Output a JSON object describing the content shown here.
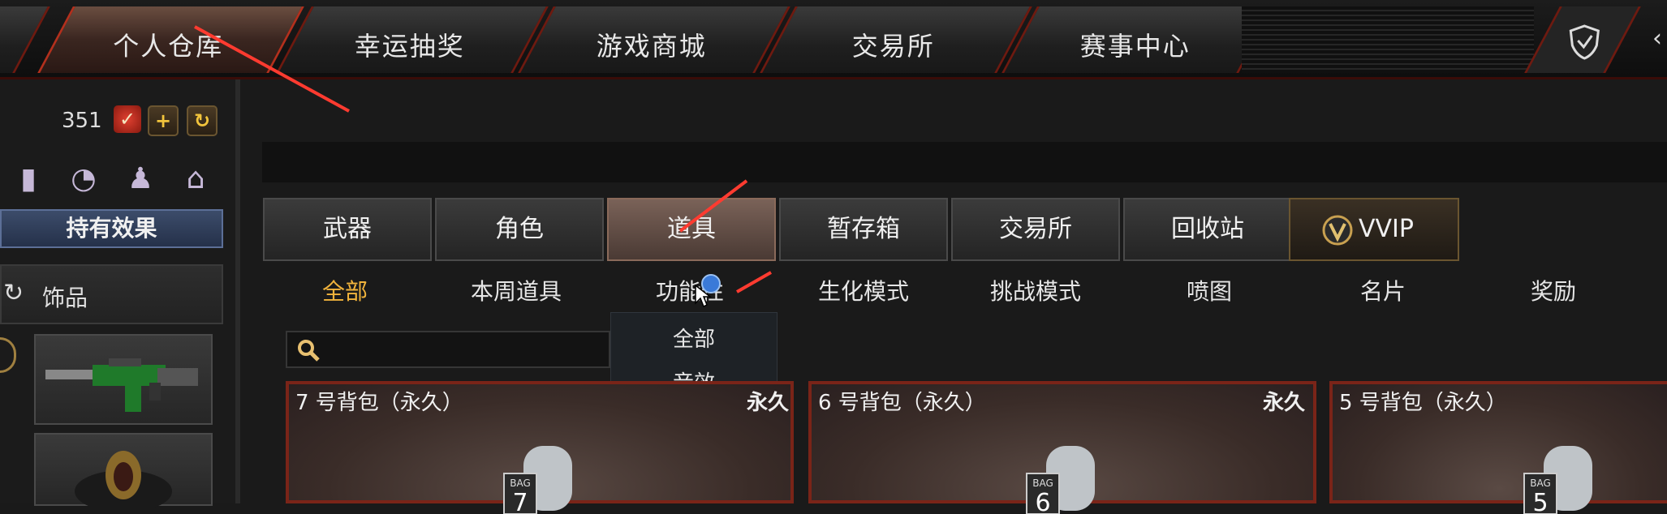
{
  "top_nav": {
    "tabs": [
      "个人仓库",
      "幸运抽奖",
      "游戏商城",
      "交易所",
      "赛事中心"
    ],
    "active_tab": "个人仓库"
  },
  "left_panel": {
    "currency_amount": "351",
    "effect_button": "持有效果",
    "accessory_label": "饰品"
  },
  "main": {
    "category_tabs": [
      "武器",
      "角色",
      "道具",
      "暂存箱",
      "交易所",
      "回收站",
      "VVIP"
    ],
    "active_category": "道具",
    "sub_tabs": [
      "全部",
      "本周道具",
      "功能性",
      "生化模式",
      "挑战模式",
      "喷图",
      "名片",
      "奖励"
    ],
    "active_sub_tab": "全部",
    "dropdown_options": [
      "全部",
      "音效"
    ],
    "items": [
      {
        "name": "7 号背包（永久）",
        "duration": "永久",
        "bag_number": "7"
      },
      {
        "name": "6 号背包（永久）",
        "duration": "永久",
        "bag_number": "6"
      },
      {
        "name": "5 号背包（永久）",
        "duration": "",
        "bag_number": "5"
      }
    ]
  },
  "colors": {
    "accent_red": "#b3301d",
    "active_subtab": "#f2b43c",
    "effect_button_blue": "#3c4c6a"
  }
}
